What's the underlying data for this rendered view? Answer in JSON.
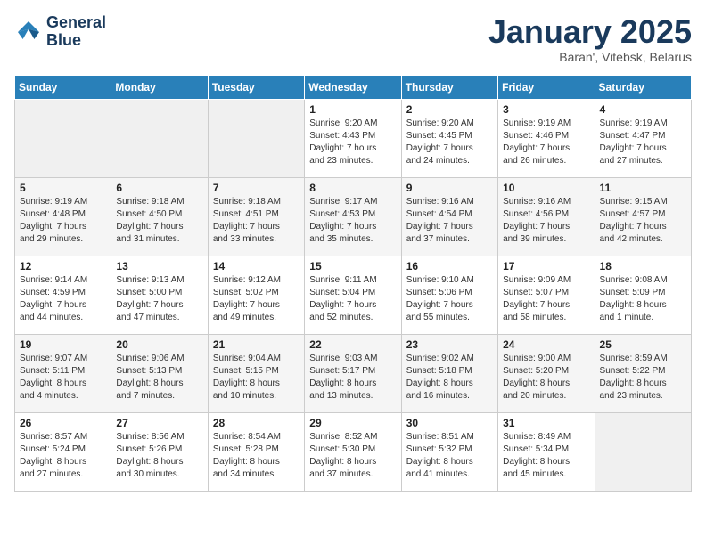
{
  "logo": {
    "line1": "General",
    "line2": "Blue"
  },
  "title": "January 2025",
  "subtitle": "Baran', Vitebsk, Belarus",
  "weekdays": [
    "Sunday",
    "Monday",
    "Tuesday",
    "Wednesday",
    "Thursday",
    "Friday",
    "Saturday"
  ],
  "weeks": [
    [
      {
        "day": "",
        "info": ""
      },
      {
        "day": "",
        "info": ""
      },
      {
        "day": "",
        "info": ""
      },
      {
        "day": "1",
        "info": "Sunrise: 9:20 AM\nSunset: 4:43 PM\nDaylight: 7 hours\nand 23 minutes."
      },
      {
        "day": "2",
        "info": "Sunrise: 9:20 AM\nSunset: 4:45 PM\nDaylight: 7 hours\nand 24 minutes."
      },
      {
        "day": "3",
        "info": "Sunrise: 9:19 AM\nSunset: 4:46 PM\nDaylight: 7 hours\nand 26 minutes."
      },
      {
        "day": "4",
        "info": "Sunrise: 9:19 AM\nSunset: 4:47 PM\nDaylight: 7 hours\nand 27 minutes."
      }
    ],
    [
      {
        "day": "5",
        "info": "Sunrise: 9:19 AM\nSunset: 4:48 PM\nDaylight: 7 hours\nand 29 minutes."
      },
      {
        "day": "6",
        "info": "Sunrise: 9:18 AM\nSunset: 4:50 PM\nDaylight: 7 hours\nand 31 minutes."
      },
      {
        "day": "7",
        "info": "Sunrise: 9:18 AM\nSunset: 4:51 PM\nDaylight: 7 hours\nand 33 minutes."
      },
      {
        "day": "8",
        "info": "Sunrise: 9:17 AM\nSunset: 4:53 PM\nDaylight: 7 hours\nand 35 minutes."
      },
      {
        "day": "9",
        "info": "Sunrise: 9:16 AM\nSunset: 4:54 PM\nDaylight: 7 hours\nand 37 minutes."
      },
      {
        "day": "10",
        "info": "Sunrise: 9:16 AM\nSunset: 4:56 PM\nDaylight: 7 hours\nand 39 minutes."
      },
      {
        "day": "11",
        "info": "Sunrise: 9:15 AM\nSunset: 4:57 PM\nDaylight: 7 hours\nand 42 minutes."
      }
    ],
    [
      {
        "day": "12",
        "info": "Sunrise: 9:14 AM\nSunset: 4:59 PM\nDaylight: 7 hours\nand 44 minutes."
      },
      {
        "day": "13",
        "info": "Sunrise: 9:13 AM\nSunset: 5:00 PM\nDaylight: 7 hours\nand 47 minutes."
      },
      {
        "day": "14",
        "info": "Sunrise: 9:12 AM\nSunset: 5:02 PM\nDaylight: 7 hours\nand 49 minutes."
      },
      {
        "day": "15",
        "info": "Sunrise: 9:11 AM\nSunset: 5:04 PM\nDaylight: 7 hours\nand 52 minutes."
      },
      {
        "day": "16",
        "info": "Sunrise: 9:10 AM\nSunset: 5:06 PM\nDaylight: 7 hours\nand 55 minutes."
      },
      {
        "day": "17",
        "info": "Sunrise: 9:09 AM\nSunset: 5:07 PM\nDaylight: 7 hours\nand 58 minutes."
      },
      {
        "day": "18",
        "info": "Sunrise: 9:08 AM\nSunset: 5:09 PM\nDaylight: 8 hours\nand 1 minute."
      }
    ],
    [
      {
        "day": "19",
        "info": "Sunrise: 9:07 AM\nSunset: 5:11 PM\nDaylight: 8 hours\nand 4 minutes."
      },
      {
        "day": "20",
        "info": "Sunrise: 9:06 AM\nSunset: 5:13 PM\nDaylight: 8 hours\nand 7 minutes."
      },
      {
        "day": "21",
        "info": "Sunrise: 9:04 AM\nSunset: 5:15 PM\nDaylight: 8 hours\nand 10 minutes."
      },
      {
        "day": "22",
        "info": "Sunrise: 9:03 AM\nSunset: 5:17 PM\nDaylight: 8 hours\nand 13 minutes."
      },
      {
        "day": "23",
        "info": "Sunrise: 9:02 AM\nSunset: 5:18 PM\nDaylight: 8 hours\nand 16 minutes."
      },
      {
        "day": "24",
        "info": "Sunrise: 9:00 AM\nSunset: 5:20 PM\nDaylight: 8 hours\nand 20 minutes."
      },
      {
        "day": "25",
        "info": "Sunrise: 8:59 AM\nSunset: 5:22 PM\nDaylight: 8 hours\nand 23 minutes."
      }
    ],
    [
      {
        "day": "26",
        "info": "Sunrise: 8:57 AM\nSunset: 5:24 PM\nDaylight: 8 hours\nand 27 minutes."
      },
      {
        "day": "27",
        "info": "Sunrise: 8:56 AM\nSunset: 5:26 PM\nDaylight: 8 hours\nand 30 minutes."
      },
      {
        "day": "28",
        "info": "Sunrise: 8:54 AM\nSunset: 5:28 PM\nDaylight: 8 hours\nand 34 minutes."
      },
      {
        "day": "29",
        "info": "Sunrise: 8:52 AM\nSunset: 5:30 PM\nDaylight: 8 hours\nand 37 minutes."
      },
      {
        "day": "30",
        "info": "Sunrise: 8:51 AM\nSunset: 5:32 PM\nDaylight: 8 hours\nand 41 minutes."
      },
      {
        "day": "31",
        "info": "Sunrise: 8:49 AM\nSunset: 5:34 PM\nDaylight: 8 hours\nand 45 minutes."
      },
      {
        "day": "",
        "info": ""
      }
    ]
  ]
}
